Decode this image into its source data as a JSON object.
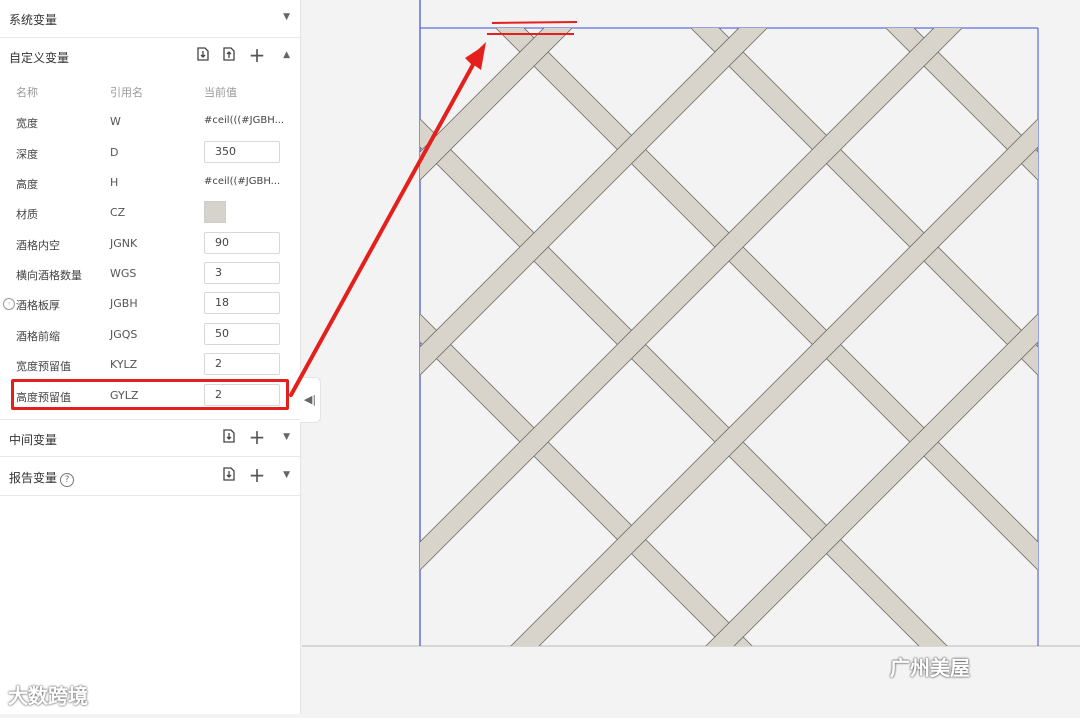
{
  "sections": {
    "system": {
      "title": "系统变量"
    },
    "custom": {
      "title": "自定义变量"
    },
    "middle": {
      "title": "中间变量"
    },
    "report": {
      "title": "报告变量"
    }
  },
  "columns": {
    "name": "名称",
    "ref": "引用名",
    "value": "当前值"
  },
  "rows": [
    {
      "name": "宽度",
      "ref": "W",
      "value": "#ceil(((#JGBH..."
    },
    {
      "name": "深度",
      "ref": "D",
      "value": "350"
    },
    {
      "name": "高度",
      "ref": "H",
      "value": "#ceil((#JGBH..."
    },
    {
      "name": "材质",
      "ref": "CZ"
    },
    {
      "name": "酒格内空",
      "ref": "JGNK",
      "value": "90"
    },
    {
      "name": "横向酒格数量",
      "ref": "WGS",
      "value": "3"
    },
    {
      "name": "酒格板厚",
      "ref": "JGBH",
      "value": "18"
    },
    {
      "name": "酒格前缩",
      "ref": "JGQS",
      "value": "50"
    },
    {
      "name": "宽度预留值",
      "ref": "KYLZ",
      "value": "2"
    },
    {
      "name": "高度预留值",
      "ref": "GYLZ",
      "value": "2"
    }
  ],
  "colors": {
    "highlight": "#e3201c",
    "material_swatch": "#d6d3cc",
    "board": "#d8d4cb",
    "guide": "#3f4fd8"
  },
  "watermarks": {
    "left": "大数跨境",
    "right": "广州美屋"
  }
}
